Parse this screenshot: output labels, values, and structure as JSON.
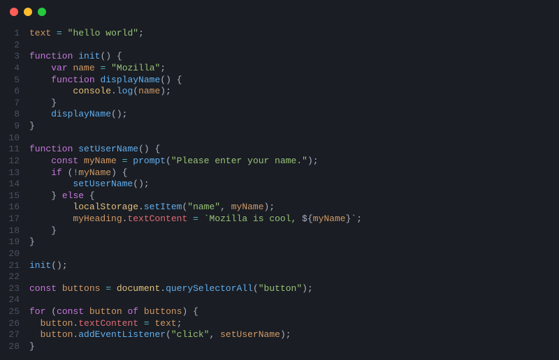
{
  "titlebar": {
    "buttons": [
      "close",
      "minimize",
      "zoom"
    ]
  },
  "code": {
    "lines": [
      {
        "n": 1,
        "tokens": [
          {
            "t": "text",
            "c": "var"
          },
          {
            "t": " ",
            "c": "punc"
          },
          {
            "t": "=",
            "c": "op"
          },
          {
            "t": " ",
            "c": "punc"
          },
          {
            "t": "\"hello world\"",
            "c": "str"
          },
          {
            "t": ";",
            "c": "punc"
          }
        ]
      },
      {
        "n": 2,
        "tokens": []
      },
      {
        "n": 3,
        "tokens": [
          {
            "t": "function",
            "c": "id"
          },
          {
            "t": " ",
            "c": "punc"
          },
          {
            "t": "init",
            "c": "fn"
          },
          {
            "t": "(",
            "c": "punc"
          },
          {
            "t": ")",
            "c": "punc"
          },
          {
            "t": " ",
            "c": "punc"
          },
          {
            "t": "{",
            "c": "punc"
          }
        ]
      },
      {
        "n": 4,
        "tokens": [
          {
            "t": "    ",
            "c": "punc"
          },
          {
            "t": "var",
            "c": "id"
          },
          {
            "t": " ",
            "c": "punc"
          },
          {
            "t": "name",
            "c": "var"
          },
          {
            "t": " ",
            "c": "punc"
          },
          {
            "t": "=",
            "c": "op"
          },
          {
            "t": " ",
            "c": "punc"
          },
          {
            "t": "\"Mozilla\"",
            "c": "str"
          },
          {
            "t": ";",
            "c": "punc"
          }
        ]
      },
      {
        "n": 5,
        "tokens": [
          {
            "t": "    ",
            "c": "punc"
          },
          {
            "t": "function",
            "c": "id"
          },
          {
            "t": " ",
            "c": "punc"
          },
          {
            "t": "displayName",
            "c": "fn"
          },
          {
            "t": "(",
            "c": "punc"
          },
          {
            "t": ")",
            "c": "punc"
          },
          {
            "t": " ",
            "c": "punc"
          },
          {
            "t": "{",
            "c": "punc"
          }
        ]
      },
      {
        "n": 6,
        "tokens": [
          {
            "t": "        ",
            "c": "punc"
          },
          {
            "t": "console",
            "c": "const"
          },
          {
            "t": ".",
            "c": "punc"
          },
          {
            "t": "log",
            "c": "fn"
          },
          {
            "t": "(",
            "c": "punc"
          },
          {
            "t": "name",
            "c": "var"
          },
          {
            "t": ")",
            "c": "punc"
          },
          {
            "t": ";",
            "c": "punc"
          }
        ]
      },
      {
        "n": 7,
        "tokens": [
          {
            "t": "    ",
            "c": "punc"
          },
          {
            "t": "}",
            "c": "punc"
          }
        ]
      },
      {
        "n": 8,
        "tokens": [
          {
            "t": "    ",
            "c": "punc"
          },
          {
            "t": "displayName",
            "c": "fn"
          },
          {
            "t": "(",
            "c": "punc"
          },
          {
            "t": ")",
            "c": "punc"
          },
          {
            "t": ";",
            "c": "punc"
          }
        ]
      },
      {
        "n": 9,
        "tokens": [
          {
            "t": "}",
            "c": "punc"
          }
        ]
      },
      {
        "n": 10,
        "tokens": []
      },
      {
        "n": 11,
        "tokens": [
          {
            "t": "function",
            "c": "id"
          },
          {
            "t": " ",
            "c": "punc"
          },
          {
            "t": "setUserName",
            "c": "fn"
          },
          {
            "t": "(",
            "c": "punc"
          },
          {
            "t": ")",
            "c": "punc"
          },
          {
            "t": " ",
            "c": "punc"
          },
          {
            "t": "{",
            "c": "punc"
          }
        ]
      },
      {
        "n": 12,
        "tokens": [
          {
            "t": "    ",
            "c": "punc"
          },
          {
            "t": "const",
            "c": "id"
          },
          {
            "t": " ",
            "c": "punc"
          },
          {
            "t": "myName",
            "c": "var"
          },
          {
            "t": " ",
            "c": "punc"
          },
          {
            "t": "=",
            "c": "op"
          },
          {
            "t": " ",
            "c": "punc"
          },
          {
            "t": "prompt",
            "c": "fn"
          },
          {
            "t": "(",
            "c": "punc"
          },
          {
            "t": "\"Please enter your name.\"",
            "c": "str"
          },
          {
            "t": ")",
            "c": "punc"
          },
          {
            "t": ";",
            "c": "punc"
          }
        ]
      },
      {
        "n": 13,
        "tokens": [
          {
            "t": "    ",
            "c": "punc"
          },
          {
            "t": "if",
            "c": "id"
          },
          {
            "t": " ",
            "c": "punc"
          },
          {
            "t": "(",
            "c": "punc"
          },
          {
            "t": "!",
            "c": "op"
          },
          {
            "t": "myName",
            "c": "var"
          },
          {
            "t": ")",
            "c": "punc"
          },
          {
            "t": " ",
            "c": "punc"
          },
          {
            "t": "{",
            "c": "punc"
          }
        ]
      },
      {
        "n": 14,
        "tokens": [
          {
            "t": "        ",
            "c": "punc"
          },
          {
            "t": "setUserName",
            "c": "fn"
          },
          {
            "t": "(",
            "c": "punc"
          },
          {
            "t": ")",
            "c": "punc"
          },
          {
            "t": ";",
            "c": "punc"
          }
        ]
      },
      {
        "n": 15,
        "tokens": [
          {
            "t": "    ",
            "c": "punc"
          },
          {
            "t": "}",
            "c": "punc"
          },
          {
            "t": " ",
            "c": "punc"
          },
          {
            "t": "else",
            "c": "id"
          },
          {
            "t": " ",
            "c": "punc"
          },
          {
            "t": "{",
            "c": "punc"
          }
        ]
      },
      {
        "n": 16,
        "tokens": [
          {
            "t": "        ",
            "c": "punc"
          },
          {
            "t": "localStorage",
            "c": "const"
          },
          {
            "t": ".",
            "c": "punc"
          },
          {
            "t": "setItem",
            "c": "fn"
          },
          {
            "t": "(",
            "c": "punc"
          },
          {
            "t": "\"name\"",
            "c": "str"
          },
          {
            "t": ",",
            "c": "punc"
          },
          {
            "t": " ",
            "c": "punc"
          },
          {
            "t": "myName",
            "c": "var"
          },
          {
            "t": ")",
            "c": "punc"
          },
          {
            "t": ";",
            "c": "punc"
          }
        ]
      },
      {
        "n": 17,
        "tokens": [
          {
            "t": "        ",
            "c": "punc"
          },
          {
            "t": "myHeading",
            "c": "var"
          },
          {
            "t": ".",
            "c": "punc"
          },
          {
            "t": "textContent",
            "c": "prop"
          },
          {
            "t": " ",
            "c": "punc"
          },
          {
            "t": "=",
            "c": "op"
          },
          {
            "t": " ",
            "c": "punc"
          },
          {
            "t": "`Mozilla is cool, ",
            "c": "str"
          },
          {
            "t": "${",
            "c": "punc"
          },
          {
            "t": "myName",
            "c": "templ-var"
          },
          {
            "t": "}",
            "c": "punc"
          },
          {
            "t": "`",
            "c": "str"
          },
          {
            "t": ";",
            "c": "punc"
          }
        ]
      },
      {
        "n": 18,
        "tokens": [
          {
            "t": "    ",
            "c": "punc"
          },
          {
            "t": "}",
            "c": "punc"
          }
        ]
      },
      {
        "n": 19,
        "tokens": [
          {
            "t": "}",
            "c": "punc"
          }
        ]
      },
      {
        "n": 20,
        "tokens": []
      },
      {
        "n": 21,
        "tokens": [
          {
            "t": "init",
            "c": "fn"
          },
          {
            "t": "(",
            "c": "punc"
          },
          {
            "t": ")",
            "c": "punc"
          },
          {
            "t": ";",
            "c": "punc"
          }
        ]
      },
      {
        "n": 22,
        "tokens": []
      },
      {
        "n": 23,
        "tokens": [
          {
            "t": "const",
            "c": "id"
          },
          {
            "t": " ",
            "c": "punc"
          },
          {
            "t": "buttons",
            "c": "var"
          },
          {
            "t": " ",
            "c": "punc"
          },
          {
            "t": "=",
            "c": "op"
          },
          {
            "t": " ",
            "c": "punc"
          },
          {
            "t": "document",
            "c": "const"
          },
          {
            "t": ".",
            "c": "punc"
          },
          {
            "t": "querySelectorAll",
            "c": "fn"
          },
          {
            "t": "(",
            "c": "punc"
          },
          {
            "t": "\"button\"",
            "c": "str"
          },
          {
            "t": ")",
            "c": "punc"
          },
          {
            "t": ";",
            "c": "punc"
          }
        ]
      },
      {
        "n": 24,
        "tokens": []
      },
      {
        "n": 25,
        "tokens": [
          {
            "t": "for",
            "c": "id"
          },
          {
            "t": " ",
            "c": "punc"
          },
          {
            "t": "(",
            "c": "punc"
          },
          {
            "t": "const",
            "c": "id"
          },
          {
            "t": " ",
            "c": "punc"
          },
          {
            "t": "button",
            "c": "var"
          },
          {
            "t": " ",
            "c": "punc"
          },
          {
            "t": "of",
            "c": "id"
          },
          {
            "t": " ",
            "c": "punc"
          },
          {
            "t": "buttons",
            "c": "var"
          },
          {
            "t": ")",
            "c": "punc"
          },
          {
            "t": " ",
            "c": "punc"
          },
          {
            "t": "{",
            "c": "punc"
          }
        ]
      },
      {
        "n": 26,
        "tokens": [
          {
            "t": "  ",
            "c": "punc"
          },
          {
            "t": "button",
            "c": "var"
          },
          {
            "t": ".",
            "c": "punc"
          },
          {
            "t": "textContent",
            "c": "prop"
          },
          {
            "t": " ",
            "c": "punc"
          },
          {
            "t": "=",
            "c": "op"
          },
          {
            "t": " ",
            "c": "punc"
          },
          {
            "t": "text",
            "c": "var"
          },
          {
            "t": ";",
            "c": "punc"
          }
        ]
      },
      {
        "n": 27,
        "tokens": [
          {
            "t": "  ",
            "c": "punc"
          },
          {
            "t": "button",
            "c": "var"
          },
          {
            "t": ".",
            "c": "punc"
          },
          {
            "t": "addEventListener",
            "c": "fn"
          },
          {
            "t": "(",
            "c": "punc"
          },
          {
            "t": "\"click\"",
            "c": "str"
          },
          {
            "t": ",",
            "c": "punc"
          },
          {
            "t": " ",
            "c": "punc"
          },
          {
            "t": "setUserName",
            "c": "var"
          },
          {
            "t": ")",
            "c": "punc"
          },
          {
            "t": ";",
            "c": "punc"
          }
        ]
      },
      {
        "n": 28,
        "tokens": [
          {
            "t": "}",
            "c": "punc"
          }
        ]
      }
    ]
  }
}
